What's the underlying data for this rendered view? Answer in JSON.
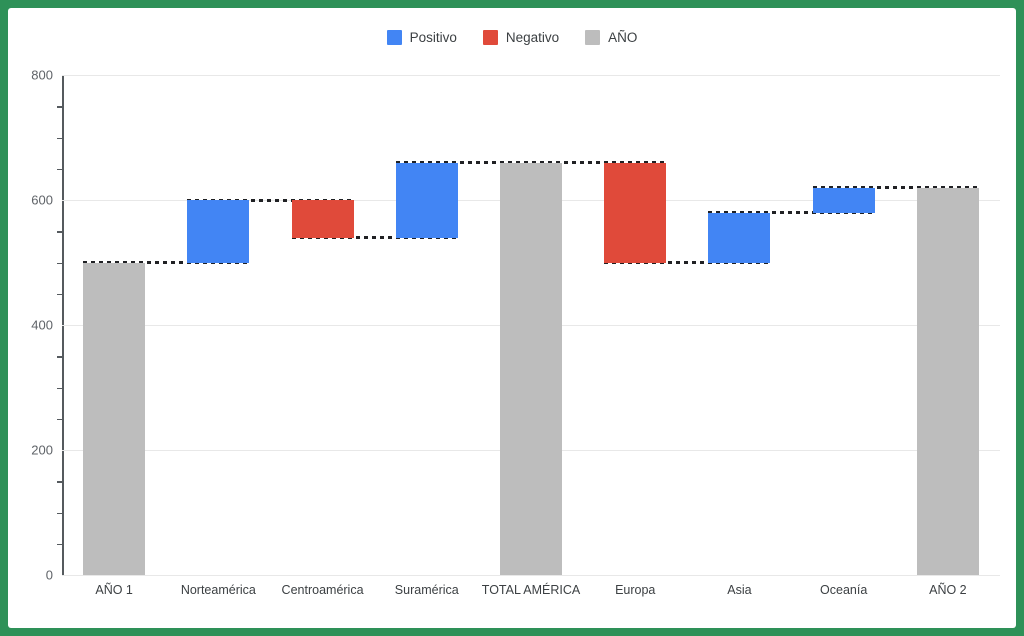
{
  "theme": {
    "frame_color": "#2e9158",
    "background": "#ffffff",
    "positive_color": "#4285f4",
    "negative_color": "#e04a3a",
    "total_color": "#bdbdbd",
    "connector_color": "#202124",
    "gridline_color": "#e8e8e8",
    "axis_color": "#555a5e"
  },
  "legend": {
    "position": "top-center",
    "items": [
      {
        "label": "Positivo",
        "color": "#4285f4",
        "swatch_name": "positive-swatch"
      },
      {
        "label": "Negativo",
        "color": "#e04a3a",
        "swatch_name": "negative-swatch"
      },
      {
        "label": "AÑO",
        "color": "#bdbdbd",
        "swatch_name": "total-swatch"
      }
    ]
  },
  "chart_data": {
    "type": "bar",
    "chart_subtype": "waterfall",
    "title": "",
    "xlabel": "",
    "ylabel": "",
    "ylim": [
      0,
      800
    ],
    "grid": true,
    "y_ticks": [
      0,
      200,
      400,
      600,
      800
    ],
    "y_tick_labels": [
      "0",
      "200",
      "400",
      "600",
      "800"
    ],
    "y_minor_tick_step": 50,
    "legend_position": "top-center",
    "categories": [
      "AÑO 1",
      "Norteamérica",
      "Centroamérica",
      "Suramérica",
      "TOTAL AMÉRICA",
      "Europa",
      "Asia",
      "Oceanía",
      "AÑO 2"
    ],
    "values": [
      500,
      100,
      -60,
      120,
      660,
      -160,
      80,
      40,
      620
    ],
    "bar_kinds": [
      "total",
      "positive",
      "negative",
      "positive",
      "total",
      "negative",
      "positive",
      "positive",
      "total"
    ],
    "bar_bases": [
      0,
      500,
      540,
      540,
      0,
      500,
      500,
      580,
      0
    ],
    "bar_tops": [
      500,
      600,
      600,
      660,
      660,
      660,
      580,
      620,
      620
    ],
    "connectors": [
      {
        "from_category": "AÑO 1",
        "to_category": "Norteamérica",
        "level": 500
      },
      {
        "from_category": "Norteamérica",
        "to_category": "Centroamérica",
        "level": 600
      },
      {
        "from_category": "Centroamérica",
        "to_category": "Suramérica",
        "level": 540
      },
      {
        "from_category": "Suramérica",
        "to_category": "TOTAL AMÉRICA",
        "level": 660
      },
      {
        "from_category": "TOTAL AMÉRICA",
        "to_category": "Europa",
        "level": 660
      },
      {
        "from_category": "Europa",
        "to_category": "Asia",
        "level": 500
      },
      {
        "from_category": "Asia",
        "to_category": "Oceanía",
        "level": 580
      },
      {
        "from_category": "Oceanía",
        "to_category": "AÑO 2",
        "level": 620
      }
    ],
    "series": [
      {
        "name": "Positivo",
        "color": "#4285f4"
      },
      {
        "name": "Negativo",
        "color": "#e04a3a"
      },
      {
        "name": "AÑO",
        "color": "#bdbdbd"
      }
    ]
  }
}
